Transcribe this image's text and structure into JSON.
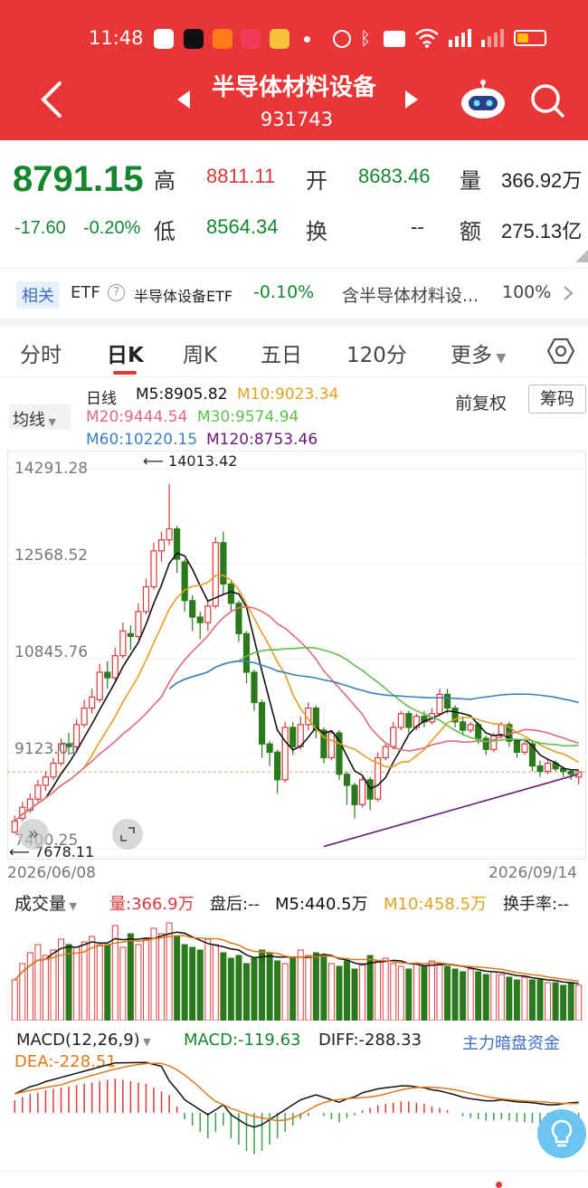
{
  "status": {
    "time": "11:48"
  },
  "nav": {
    "title": "半导体材料设备",
    "code": "931743"
  },
  "quote": {
    "price": "8791.15",
    "change": "-17.60",
    "change_pct": "-0.20%",
    "high_label": "高",
    "high": "8811.11",
    "open_label": "开",
    "open": "8683.46",
    "vol_label": "量",
    "volume": "366.92万",
    "low_label": "低",
    "low": "8564.34",
    "turnover_label": "换",
    "turnover": "--",
    "amount_label": "额",
    "amount": "275.13亿"
  },
  "etf": {
    "tag": "相关",
    "label": "ETF",
    "name": "半导体设备ETF",
    "pct": "-0.10%",
    "related": "含半导体材料设...",
    "related_pct": "100%"
  },
  "tabs": [
    "分时",
    "日K",
    "周K",
    "五日",
    "120分",
    "更多"
  ],
  "ma_panel": {
    "mode": "均线",
    "period": "日线",
    "m5": "M5:8905.82",
    "m10": "M10:9023.34",
    "m20": "M20:9444.54",
    "m30": "M30:9574.94",
    "m60": "M60:10220.15",
    "m120": "M120:8753.46",
    "adjust": "前复权",
    "chip": "筹码"
  },
  "price_axis": {
    "top": "14291.28",
    "mid1": "12568.52",
    "mid2": "10845.76",
    "mid3": "9123.01",
    "bottom": "7400.25",
    "max_label": "14013.42",
    "min_label": "7678.11",
    "start_date": "2026/06/08",
    "end_date": "2026/09/14"
  },
  "volume_panel": {
    "mode": "成交量",
    "vol": "量:366.9万",
    "after": "盘后:--",
    "m5": "M5:440.5万",
    "m10": "M10:458.5万",
    "turn": "换手率:--"
  },
  "macd_panel": {
    "mode": "MACD(12,26,9)",
    "macd": "MACD:-119.63",
    "diff": "DIFF:-288.33",
    "dea": "DEA:-228.51",
    "funds": "主力暗盘资金"
  },
  "colors": {
    "header": "#e83535",
    "up": "#d93a3a",
    "down": "#2a7a1c",
    "m5": "#111111",
    "m10": "#e0a020",
    "m20": "#e06a78",
    "m30": "#5cc04a",
    "m60": "#3a7fc0",
    "m120": "#6a1a7a"
  },
  "chart_data": {
    "type": "candlestick",
    "x_start": "2026/06/08",
    "x_end": "2026/09/14",
    "ylim": [
      7400.25,
      14291.28
    ],
    "candles": [
      [
        7700,
        7900,
        7678,
        8000
      ],
      [
        7950,
        8150,
        7900,
        8250
      ],
      [
        8100,
        8300,
        8050,
        8400
      ],
      [
        8300,
        8550,
        8250,
        8650
      ],
      [
        8550,
        8700,
        8450,
        8800
      ],
      [
        8700,
        8950,
        8650,
        9050
      ],
      [
        8950,
        9300,
        8900,
        9400
      ],
      [
        9300,
        9250,
        9100,
        9500
      ],
      [
        9250,
        9650,
        9200,
        9750
      ],
      [
        9650,
        9950,
        9600,
        10100
      ],
      [
        9950,
        10150,
        9850,
        10300
      ],
      [
        10100,
        10600,
        10050,
        10750
      ],
      [
        10600,
        10500,
        10300,
        10800
      ],
      [
        10500,
        10900,
        10450,
        11050
      ],
      [
        10900,
        11350,
        10850,
        11500
      ],
      [
        11300,
        11250,
        11000,
        11450
      ],
      [
        11250,
        11700,
        11200,
        11850
      ],
      [
        11700,
        12150,
        11650,
        12300
      ],
      [
        12150,
        12800,
        12100,
        12950
      ],
      [
        12800,
        13000,
        12600,
        13150
      ],
      [
        13000,
        13200,
        12900,
        14013
      ],
      [
        13200,
        12650,
        12400,
        13250
      ],
      [
        12600,
        11900,
        11700,
        12650
      ],
      [
        11900,
        11600,
        11350,
        12000
      ],
      [
        11600,
        11500,
        11200,
        11700
      ],
      [
        11500,
        11800,
        11350,
        11900
      ],
      [
        11800,
        12950,
        11750,
        13050
      ],
      [
        12950,
        12200,
        12000,
        13150
      ],
      [
        12200,
        11850,
        11700,
        12250
      ],
      [
        11850,
        11300,
        11150,
        11900
      ],
      [
        11300,
        10600,
        10400,
        11350
      ],
      [
        10600,
        10050,
        9900,
        10650
      ],
      [
        10050,
        9300,
        9050,
        10100
      ],
      [
        9300,
        9150,
        8900,
        9350
      ],
      [
        9150,
        8650,
        8400,
        9200
      ],
      [
        8650,
        9600,
        8600,
        9700
      ],
      [
        9600,
        9250,
        9100,
        9700
      ],
      [
        9250,
        9650,
        9200,
        9800
      ],
      [
        9650,
        9950,
        9550,
        10050
      ],
      [
        9950,
        9550,
        9400,
        10000
      ],
      [
        9550,
        9050,
        8950,
        9600
      ],
      [
        9050,
        9500,
        9000,
        9550
      ],
      [
        9500,
        8750,
        8650,
        9550
      ],
      [
        8750,
        8550,
        8200,
        8800
      ],
      [
        8550,
        8200,
        7950,
        8600
      ],
      [
        8200,
        8650,
        8150,
        8700
      ],
      [
        8650,
        8300,
        8100,
        8700
      ],
      [
        8300,
        9050,
        8250,
        9150
      ],
      [
        9050,
        9250,
        9000,
        9300
      ],
      [
        9250,
        9600,
        9200,
        9700
      ],
      [
        9600,
        9850,
        9550,
        9900
      ],
      [
        9850,
        9600,
        9500,
        9900
      ],
      [
        9600,
        9800,
        9550,
        9850
      ],
      [
        9800,
        9700,
        9600,
        9900
      ],
      [
        9700,
        9850,
        9650,
        9950
      ],
      [
        9850,
        10200,
        9800,
        10300
      ],
      [
        10200,
        9950,
        9850,
        10300
      ],
      [
        9950,
        9700,
        9600,
        10000
      ],
      [
        9700,
        9550,
        9450,
        9800
      ],
      [
        9550,
        9650,
        9500,
        9700
      ],
      [
        9650,
        9400,
        9300,
        9700
      ],
      [
        9400,
        9200,
        9100,
        9450
      ],
      [
        9200,
        9450,
        9150,
        9500
      ],
      [
        9450,
        9650,
        9400,
        9700
      ],
      [
        9650,
        9350,
        9250,
        9700
      ],
      [
        9350,
        9150,
        9050,
        9400
      ],
      [
        9150,
        9300,
        9100,
        9350
      ],
      [
        9300,
        8900,
        8800,
        9350
      ],
      [
        8900,
        8800,
        8700,
        9000
      ],
      [
        8800,
        8950,
        8750,
        9000
      ],
      [
        8950,
        8850,
        8800,
        9000
      ],
      [
        8850,
        8800,
        8700,
        8900
      ],
      [
        8800,
        8750,
        8650,
        8850
      ],
      [
        8700,
        8791,
        8564,
        8811
      ]
    ]
  },
  "volume_data": {
    "values": [
      300,
      420,
      500,
      560,
      480,
      520,
      600,
      560,
      540,
      580,
      620,
      560,
      560,
      700,
      540,
      640,
      560,
      600,
      680,
      640,
      720,
      620,
      560,
      540,
      520,
      600,
      560,
      500,
      460,
      480,
      420,
      460,
      520,
      500,
      440,
      420,
      460,
      520,
      480,
      500,
      480,
      420,
      400,
      440,
      380,
      420,
      480,
      440,
      460,
      420,
      400,
      380,
      420,
      400,
      440,
      420,
      400,
      380,
      360,
      380,
      360,
      340,
      360,
      340,
      320,
      300,
      320,
      300,
      300,
      280,
      280,
      260,
      280,
      260
    ]
  },
  "macd_data": {
    "values": [
      20,
      25,
      30,
      32,
      36,
      38,
      40,
      42,
      44,
      46,
      48,
      50,
      52,
      54,
      52,
      50,
      48,
      46,
      40,
      34,
      28,
      10,
      -10,
      -20,
      -30,
      -40,
      -30,
      -20,
      -40,
      -50,
      -60,
      -65,
      -60,
      -50,
      -40,
      -30,
      -20,
      -10,
      -5,
      0,
      -5,
      -10,
      -15,
      -8,
      -4,
      4,
      8,
      12,
      14,
      16,
      18,
      18,
      16,
      14,
      10,
      8,
      4,
      0,
      -5,
      -8,
      -10,
      -12,
      -12,
      -10,
      -12,
      -14,
      -15,
      -16,
      -18,
      -20,
      -20,
      -18,
      -16,
      -15
    ]
  }
}
